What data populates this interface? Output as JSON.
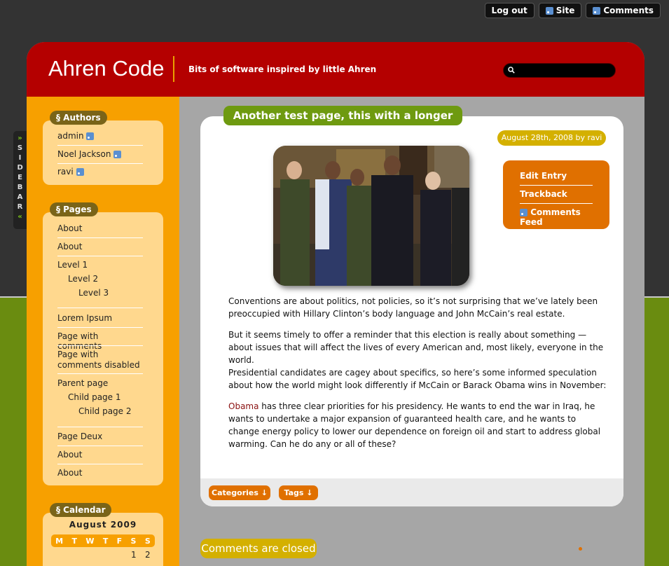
{
  "top_links": {
    "logout": "Log out",
    "site": "Site",
    "comments": "Comments"
  },
  "sidebar_tab": {
    "label": "SIDEBAR",
    "arrow_top": "»",
    "arrow_bottom": "«"
  },
  "header": {
    "title": "Ahren Code",
    "tagline": "Bits of software inspired by little Ahren"
  },
  "authors": {
    "title": "§ Authors",
    "items": [
      "admin",
      "Noel Jackson",
      "ravi"
    ]
  },
  "pages": {
    "title": "§ Pages",
    "items": [
      "About",
      "About",
      "Level 1",
      "Level 2",
      "Level 3",
      "Lorem Ipsum",
      "Page with comments",
      "Page with comments disabled",
      "Parent page",
      "Child page 1",
      "Child page 2",
      "Page Deux",
      "About",
      "About"
    ]
  },
  "calendar": {
    "title": "§ Calendar",
    "month": "August 2009",
    "days": [
      "M",
      "T",
      "W",
      "T",
      "F",
      "S",
      "S"
    ],
    "first_row": [
      "1",
      "2"
    ]
  },
  "post": {
    "title": "Another test page, this with a longer title",
    "date": "August 28th, 2008 by ravi",
    "actions": [
      "Edit Entry",
      "Trackback",
      "Comments Feed"
    ],
    "p1": "Conventions are about politics, not policies, so it’s not surprising that we’ve lately been preoccupied with Hillary Clinton’s body language and John McCain’s real estate.",
    "p2": "But it seems timely to offer a reminder that this election is really about something — about issues that will affect the lives of every American and, most likely, everyone in the world.",
    "p3": "Presidential candidates are cagey about specifics, so here’s some informed speculation about how the world might look differently if McCain or Barack Obama wins in November:",
    "p4_link": "Obama",
    "p4": " has three clear priorities for his presidency. He wants to end the war in Iraq, he wants to undertake a major expansion of guaranteed health care, and he wants to change energy policy to lower our dependence on foreign oil and start to address global warming. Can he do any or all of these?",
    "categories": "Categories ↓",
    "tags": "Tags ↓"
  },
  "comments_closed": "Comments are closed"
}
